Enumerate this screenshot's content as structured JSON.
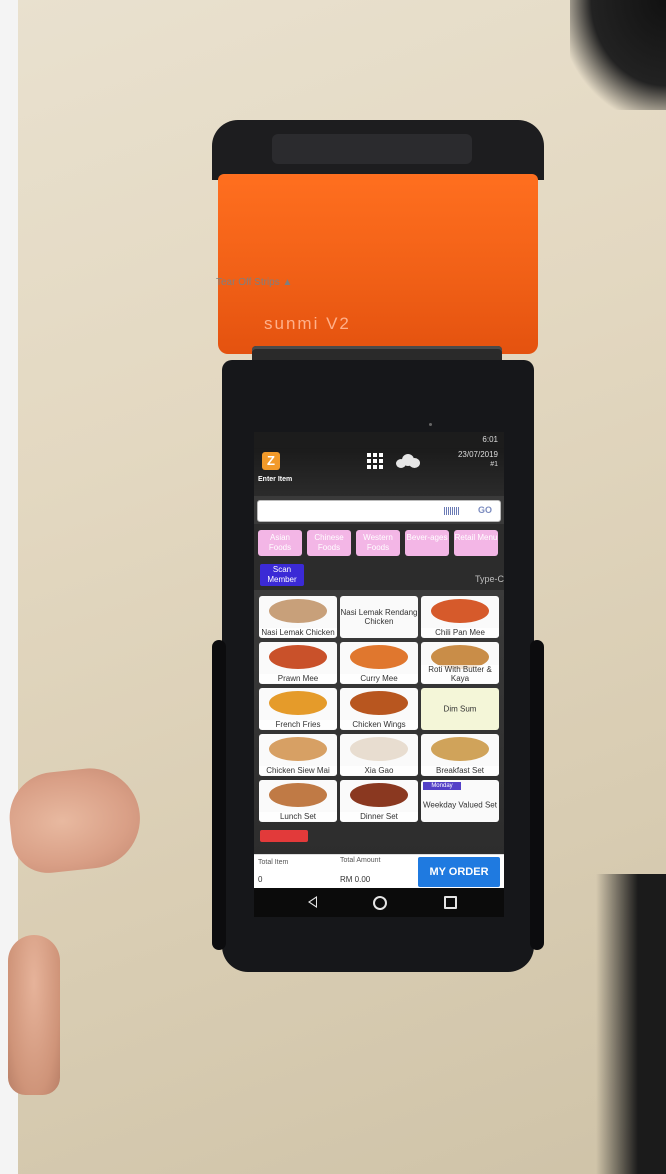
{
  "device": {
    "brand": "sunmi V2",
    "tear_label": "Tear Off Strips ▲"
  },
  "status_bar": {
    "time": "6:01"
  },
  "header": {
    "date": "23/07/2019",
    "number": "#1",
    "enter_item_label": "Enter Item"
  },
  "search": {
    "placeholder": "",
    "go_label": "GO"
  },
  "categories": [
    {
      "label": "Asian Foods"
    },
    {
      "label": "Chinese Foods"
    },
    {
      "label": "Western Foods"
    },
    {
      "label": "Bever-ages"
    },
    {
      "label": "Retail Menu"
    }
  ],
  "scan_member": {
    "label": "Scan Member"
  },
  "type_c_label": "Type-C",
  "items": [
    {
      "label": "Nasi Lemak Chicken",
      "color": "#c8a07a"
    },
    {
      "label": "Nasi Lemak Rendang Chicken",
      "color": ""
    },
    {
      "label": "Chili Pan Mee",
      "color": "#d65a2b"
    },
    {
      "label": "Prawn Mee",
      "color": "#c9512a"
    },
    {
      "label": "Curry Mee",
      "color": "#e0772e"
    },
    {
      "label": "Roti With Butter & Kaya",
      "color": "#c98d48"
    },
    {
      "label": "French Fries",
      "color": "#e59b2a"
    },
    {
      "label": "Chicken Wings",
      "color": "#b8561f"
    },
    {
      "label": "Dim Sum",
      "color": ""
    },
    {
      "label": "Chicken Siew Mai",
      "color": "#d7a064"
    },
    {
      "label": "Xia Gao",
      "color": "#e8ddd0"
    },
    {
      "label": "Breakfast Set",
      "color": "#d0a35a"
    },
    {
      "label": "Lunch Set",
      "color": "#c07a45"
    },
    {
      "label": "Dinner Set",
      "color": "#8a3820"
    },
    {
      "label": "Weekday Valued Set",
      "color": ""
    }
  ],
  "weekday_tag": "Monday",
  "bottom": {
    "total_item_label": "Total Item",
    "total_item_value": "0",
    "total_amount_label": "Total Amount",
    "total_amount_value": "RM 0.00",
    "my_order_label": "MY ORDER"
  },
  "colors": {
    "category_pink": "#f3b6e6",
    "scan_purple": "#3b2ad6",
    "order_blue": "#1f7ae0",
    "device_orange": "#f05f16"
  }
}
